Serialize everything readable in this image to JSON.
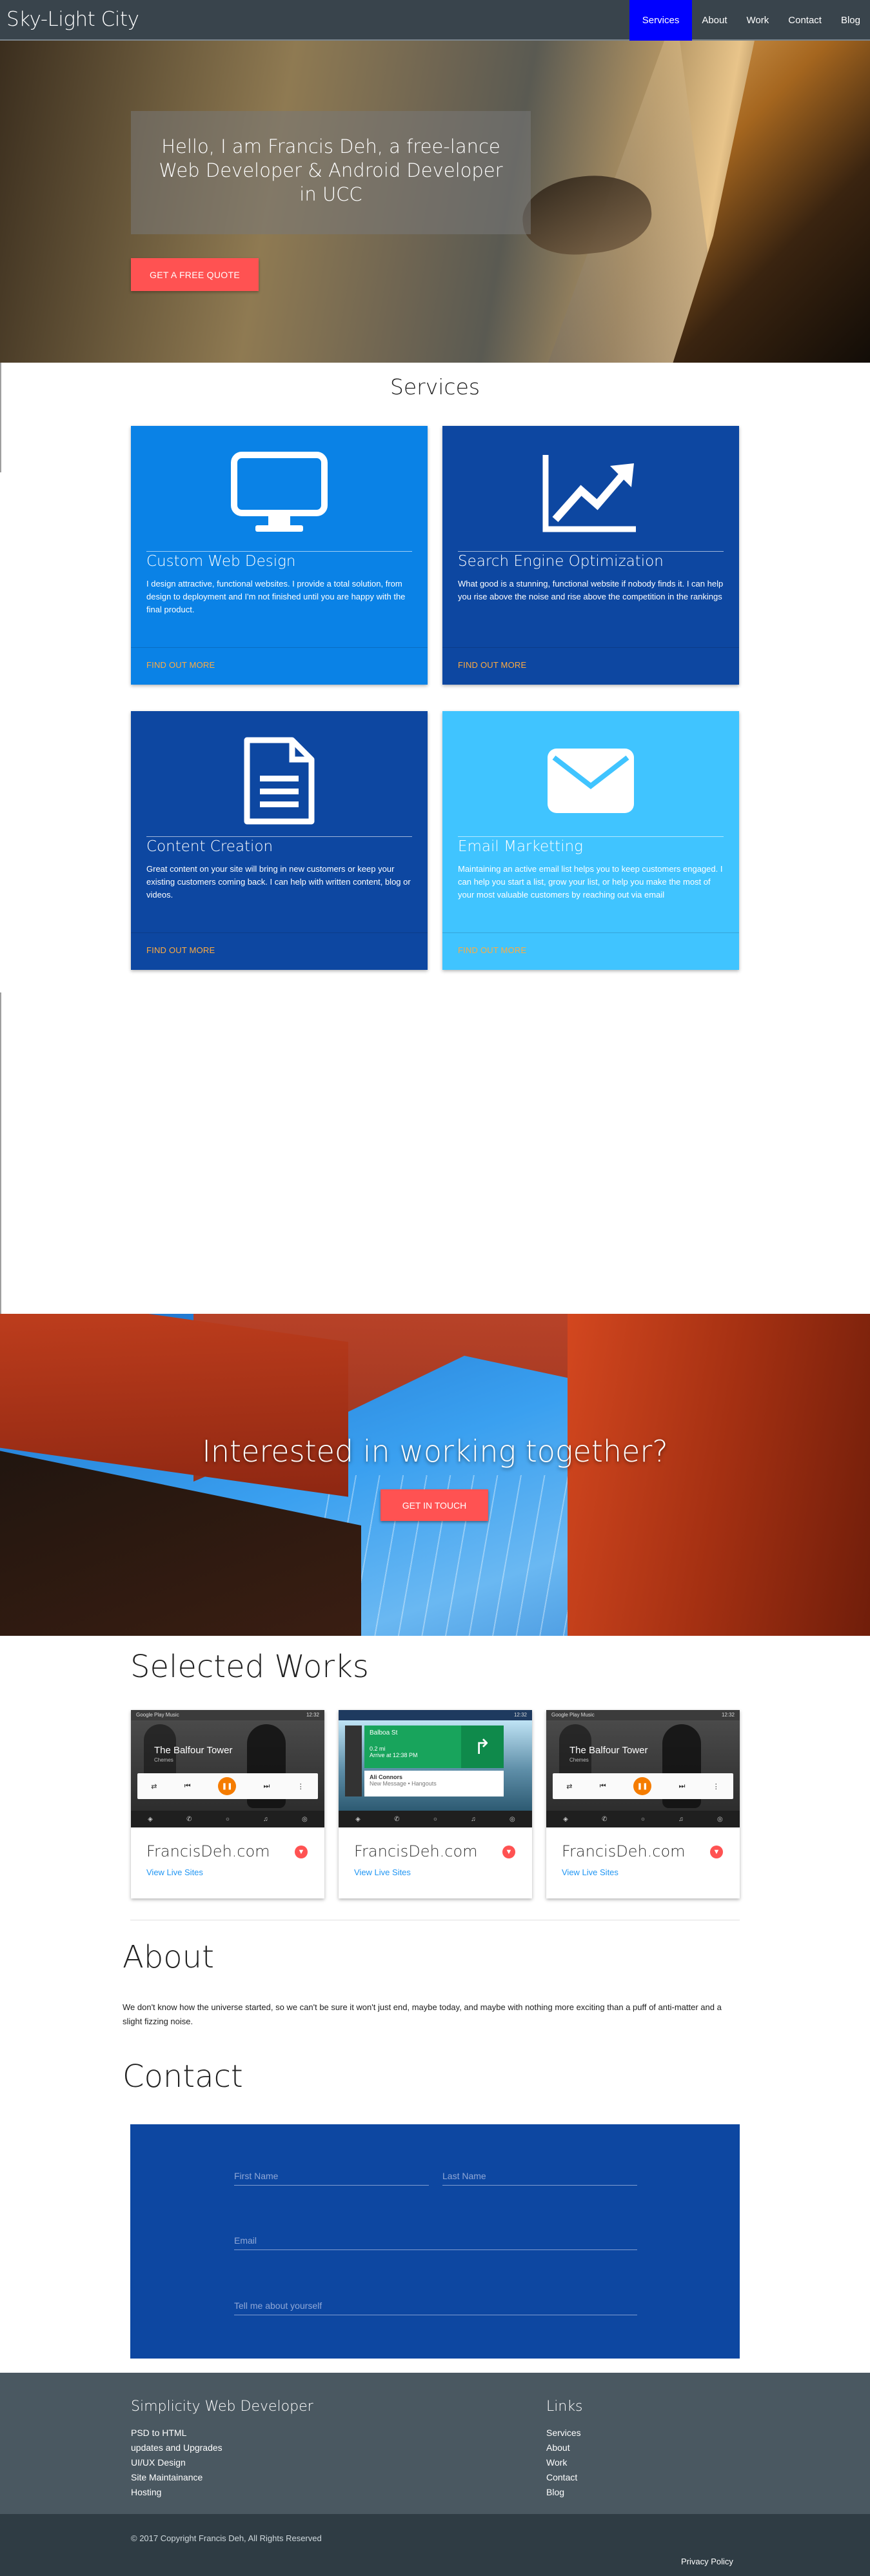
{
  "nav": {
    "brand": "Sky-Light City",
    "links": [
      "Services",
      "About",
      "Work",
      "Contact",
      "Blog"
    ]
  },
  "hero": {
    "title": "Hello, I am Francis Deh, a free-lance Web Developer & Android Developer in UCC",
    "button": "GET A FREE QUOTE"
  },
  "services": {
    "title": "Services",
    "cards": [
      {
        "icon": "monitor-icon",
        "color": "#0a82e6",
        "title": "Custom Web Design",
        "text": "I design attractive, functional websites. I provide a total solution, from design to deployment and I'm not finished until you are happy with the final product.",
        "link": "FIND OUT MORE"
      },
      {
        "icon": "chart-icon",
        "color": "#0d47a1",
        "title": "Search Engine Optimization",
        "text": "What good is a stunning, functional website if nobody finds it. I can help you rise above the noise and rise above the competition in the rankings",
        "link": "FIND OUT MORE"
      },
      {
        "icon": "document-icon",
        "color": "#0d47a1",
        "title": "Content Creation",
        "text": "Great content on your site will bring in new customers or keep your existing customers coming back. I can help with written content, blog or videos.",
        "link": "FIND OUT MORE"
      },
      {
        "icon": "envelope-icon",
        "color": "#40c4ff",
        "title": "Email Marketting",
        "text": "Maintaining an active email list helps you to keep customers engaged. I can help you start a list, grow your list, or help you make the most of your most valuable customers by reaching out via email",
        "link": "FIND OUT MORE"
      }
    ]
  },
  "cta": {
    "title": "Interested in working together?",
    "button": "GET IN TOUCH"
  },
  "works": {
    "title": "Selected Works",
    "items": [
      {
        "name": "FrancisDeh.com",
        "link": "View Live Sites",
        "shot": {
          "app": "Google Play Music",
          "time": "12:32",
          "song": "The Balfour Tower",
          "artist": "Chemes"
        }
      },
      {
        "name": "FrancisDeh.com",
        "link": "View Live Sites",
        "shot": {
          "app": "Balboa St",
          "time": "12:32",
          "distance": "0.2 mi",
          "eta": "Arrive at 12:38 PM",
          "contact": "Ali Connors",
          "message": "New Message • Hangouts"
        }
      },
      {
        "name": "FrancisDeh.com",
        "link": "View Live Sites",
        "shot": {
          "app": "Google Play Music",
          "time": "12:32",
          "song": "The Balfour Tower",
          "artist": "Chemes"
        }
      }
    ]
  },
  "about": {
    "title": "About",
    "text": "We don't know how the universe started, so we can't be sure it won't just end, maybe today, and maybe with nothing more exciting than a puff of anti-matter and a slight fizzing noise."
  },
  "contact": {
    "title": "Contact",
    "first_name": "First Name",
    "last_name": "Last Name",
    "email": "Email",
    "message": "Tell me about yourself"
  },
  "footer": {
    "left_title": "Simplicity Web Developer",
    "left_items": [
      "PSD to HTML",
      "updates and Upgrades",
      "UI/UX Design",
      "Site Maintainance",
      "Hosting"
    ],
    "right_title": "Links",
    "right_items": [
      "Services",
      "About",
      "Work",
      "Contact",
      "Blog"
    ],
    "copyright": "© 2017 Copyright Francis Deh, All Rights Reserved",
    "privacy": "Privacy Policy"
  }
}
